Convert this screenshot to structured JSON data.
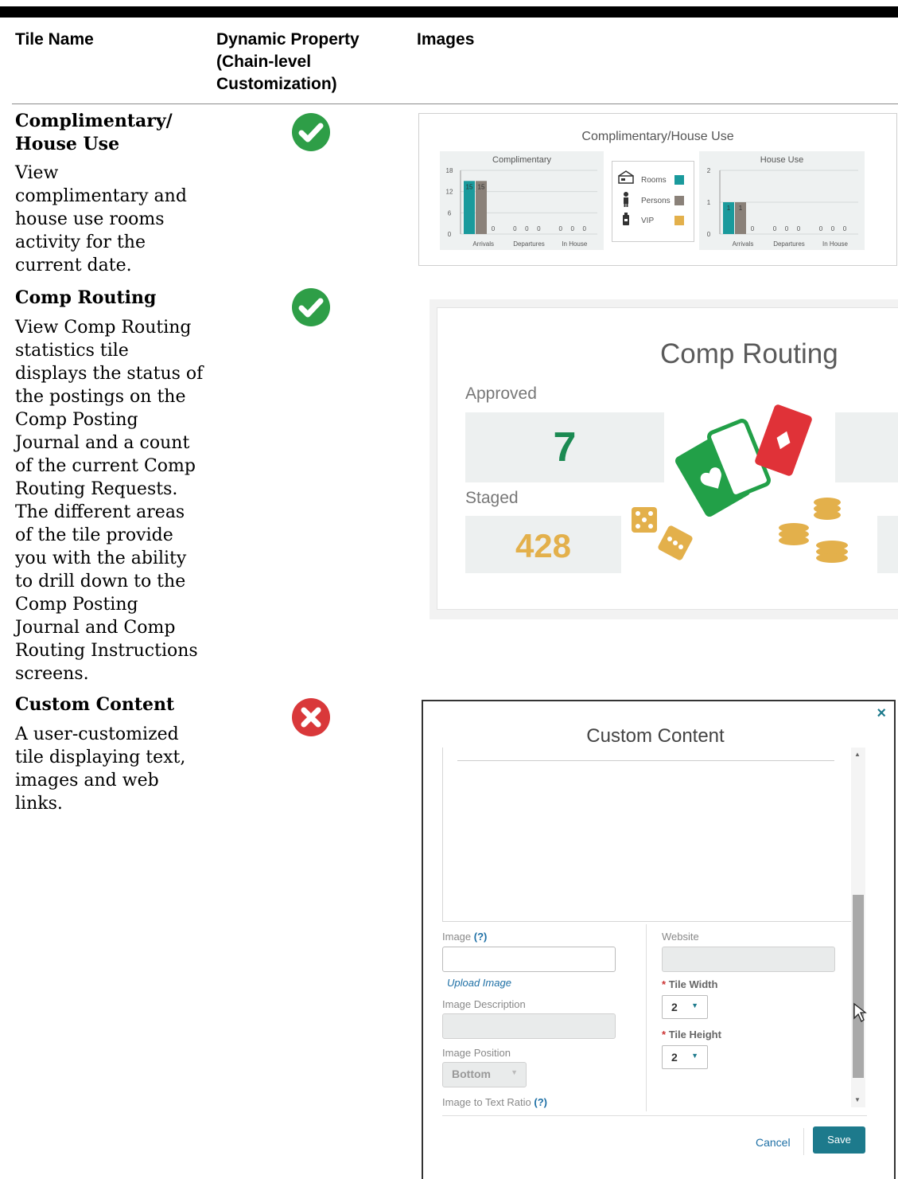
{
  "table": {
    "headers": [
      "Tile Name",
      "Dynamic Property (Chain-level Customization)",
      "Images"
    ],
    "header_lines": {
      "col1": [
        "Tile Name"
      ],
      "col2": [
        "Dynamic Property",
        "(Chain-level",
        "Customization)"
      ],
      "col3": [
        "Images"
      ]
    },
    "rows": [
      {
        "title_lines": [
          "Complimentary/",
          "House Use"
        ],
        "desc_lines": [
          "View",
          "complimentary and",
          "house use rooms",
          "activity for the",
          "current date."
        ],
        "dynamic": "check-icon"
      },
      {
        "title_lines": [
          "Comp Routing"
        ],
        "desc_lines": [
          "View Comp Routing",
          "statistics tile",
          "displays the status of",
          "the postings on the",
          "Comp Posting",
          "Journal and a count",
          "of the current Comp",
          "Routing Requests.",
          "The different areas",
          "of the tile provide",
          "you with the ability",
          "to drill down to the",
          "Comp Posting",
          "Journal and Comp",
          "Routing Instructions",
          "screens."
        ],
        "dynamic": "check-icon"
      },
      {
        "title_lines": [
          "Custom Content"
        ],
        "desc_lines": [
          "A user-customized",
          "tile displaying text,",
          "images and web",
          "links."
        ],
        "dynamic": "cross-icon"
      }
    ]
  },
  "colors": {
    "check": "#2e9e47",
    "cross": "#d9383a",
    "teal": "#1a9a9c",
    "gray": "#8a8179",
    "gold": "#e3b04b",
    "green_value": "#1b8a52",
    "save": "#1d7a8c"
  },
  "complimentary_tile": {
    "title": "Complimentary/House Use",
    "legend": [
      "Rooms",
      "Persons",
      "VIP"
    ],
    "left_chart": {
      "title": "Complimentary",
      "y_ticks": [
        "18",
        "12",
        "6",
        "0"
      ],
      "categories": [
        "Arrivals",
        "Departures",
        "In House"
      ],
      "value_labels": [
        [
          "15",
          "15",
          "0"
        ],
        [
          "0",
          "0",
          "0"
        ],
        [
          "0",
          "0",
          "0"
        ]
      ]
    },
    "right_chart": {
      "title": "House Use",
      "y_ticks": [
        "2",
        "1",
        "0"
      ],
      "categories": [
        "Arrivals",
        "Departures",
        "In House"
      ],
      "value_labels": [
        [
          "1",
          "1",
          "0"
        ],
        [
          "0",
          "0",
          "0"
        ],
        [
          "0",
          "0",
          "0"
        ]
      ]
    }
  },
  "chart_data": [
    {
      "type": "bar",
      "title": "Complimentary",
      "categories": [
        "Arrivals",
        "Departures",
        "In House"
      ],
      "series": [
        {
          "name": "Rooms",
          "values": [
            15,
            0,
            0
          ]
        },
        {
          "name": "Persons",
          "values": [
            15,
            0,
            0
          ]
        },
        {
          "name": "VIP",
          "values": [
            0,
            0,
            0
          ]
        }
      ],
      "ylim": [
        0,
        18
      ]
    },
    {
      "type": "bar",
      "title": "House Use",
      "categories": [
        "Arrivals",
        "Departures",
        "In House"
      ],
      "series": [
        {
          "name": "Rooms",
          "values": [
            1,
            0,
            0
          ]
        },
        {
          "name": "Persons",
          "values": [
            1,
            0,
            0
          ]
        },
        {
          "name": "VIP",
          "values": [
            0,
            0,
            0
          ]
        }
      ],
      "ylim": [
        0,
        2
      ]
    }
  ],
  "comp_routing_tile": {
    "title": "Comp Routing",
    "approved_label": "Approved",
    "approved_value": "7",
    "staged_label": "Staged",
    "staged_value": "428"
  },
  "custom_content_tile": {
    "title": "Custom Content",
    "close": "×",
    "image_label": "Image",
    "help": "(?)",
    "upload_link": "Upload Image",
    "image_description_label": "Image Description",
    "image_position_label": "Image Position",
    "image_position_value": "Bottom",
    "image_text_ratio_label": "Image to Text Ratio",
    "website_label": "Website",
    "required_mark": "*",
    "tile_width_label": "Tile Width",
    "tile_width_value": "2",
    "tile_height_label": "Tile Height",
    "tile_height_value": "2",
    "cancel": "Cancel",
    "save": "Save"
  }
}
